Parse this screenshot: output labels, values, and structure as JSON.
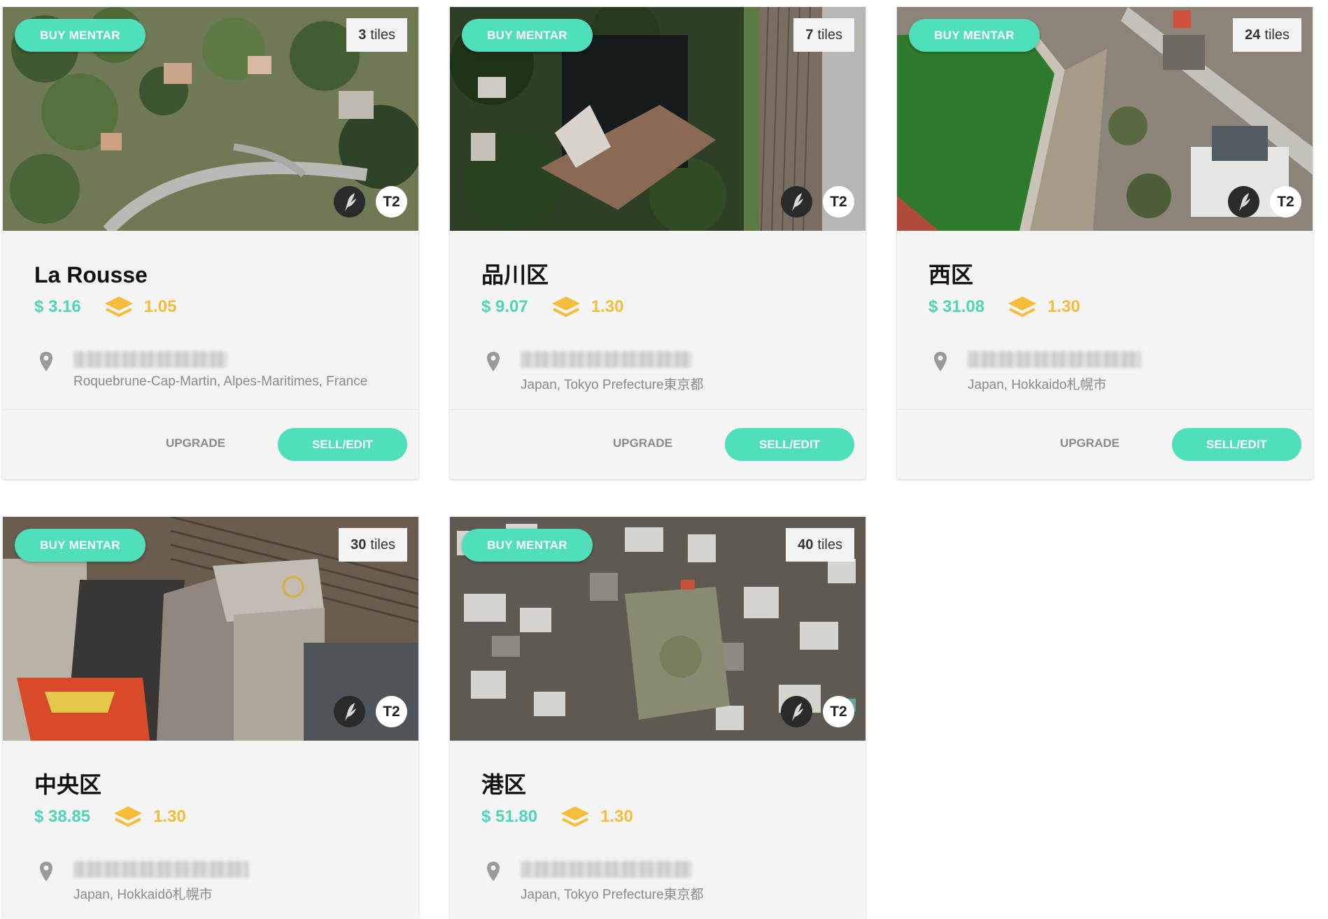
{
  "colors": {
    "accent": "#4fe0bb",
    "price": "#4fd6b4",
    "multiplier": "#f6bd3a"
  },
  "labels": {
    "buy": "BUY MENTAR",
    "upgrade": "UPGRADE",
    "sell": "SELL/EDIT",
    "tiles_unit": "tiles"
  },
  "cards": [
    {
      "title": "La Rousse",
      "tiles": "3",
      "tier": "T2",
      "price": "$ 3.16",
      "multiplier": "1.05",
      "address": "Roquebrune-Cap-Martin, Alpes-Maritimes, France"
    },
    {
      "title": "品川区",
      "tiles": "7",
      "tier": "T2",
      "price": "$ 9.07",
      "multiplier": "1.30",
      "address": "Japan, Tokyo Prefecture東京都"
    },
    {
      "title": "西区",
      "tiles": "24",
      "tier": "T2",
      "price": "$ 31.08",
      "multiplier": "1.30",
      "address": "Japan, Hokkaido札幌市"
    },
    {
      "title": "中央区",
      "tiles": "30",
      "tier": "T2",
      "price": "$ 38.85",
      "multiplier": "1.30",
      "address": "Japan, Hokkaidō札幌市"
    },
    {
      "title": "港区",
      "tiles": "40",
      "tier": "T2",
      "price": "$ 51.80",
      "multiplier": "1.30",
      "address": "Japan, Tokyo Prefecture東京都"
    }
  ]
}
